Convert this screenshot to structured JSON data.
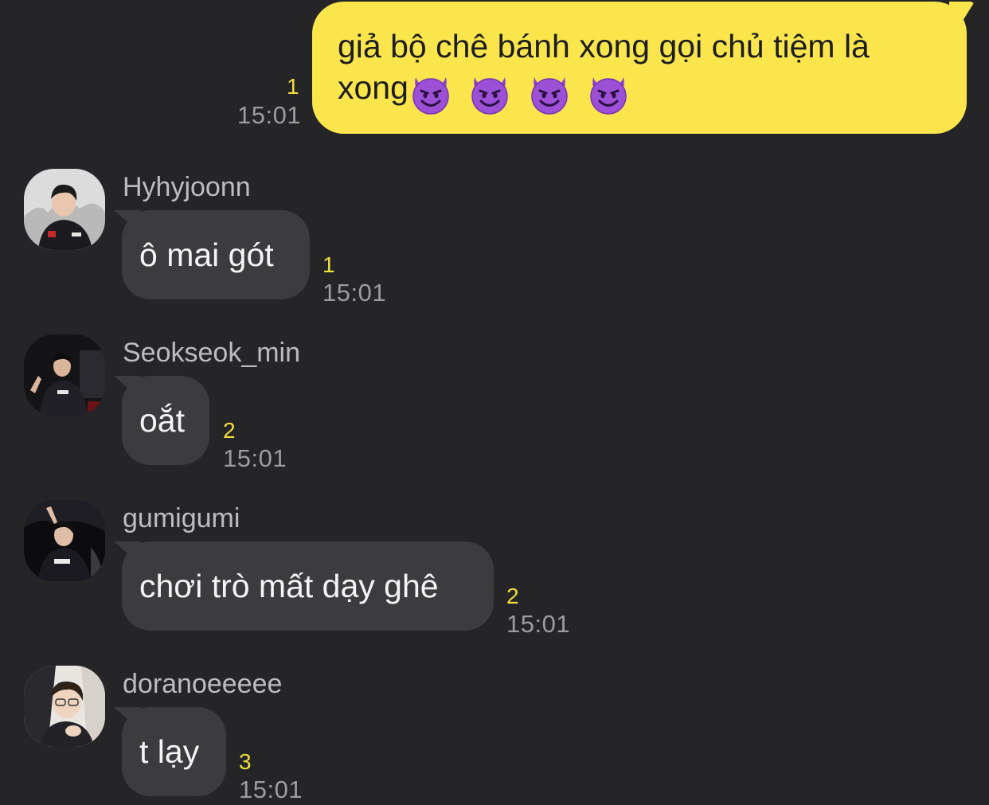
{
  "colors": {
    "background": "#252527",
    "outgoing_bubble": "#fae54d",
    "incoming_bubble": "#3c3c3e",
    "unread_count": "#f1df3e",
    "timestamp": "#9c9ca0",
    "sender_name": "#bdbdc1"
  },
  "outgoing": {
    "text": "giả bộ chê bánh xong gọi chủ tiệm là xong",
    "emoji": [
      "smiling-imp",
      "smiling-imp",
      "smiling-imp",
      "smiling-imp"
    ],
    "unread": "1",
    "time": "15:01"
  },
  "messages": [
    {
      "sender": "Hyhyjoonn",
      "avatar": "avatar-hyhyjoonn",
      "text": "ô mai gót",
      "unread": "1",
      "time": "15:01"
    },
    {
      "sender": "Seokseok_min",
      "avatar": "avatar-seokseok-min",
      "text": "oắt",
      "unread": "2",
      "time": "15:01"
    },
    {
      "sender": "gumigumi",
      "avatar": "avatar-gumigumi",
      "text": "chơi trò mất dạy ghê",
      "unread": "2",
      "time": "15:01"
    },
    {
      "sender": "doranoeeeee",
      "avatar": "avatar-doranoeeeee",
      "text": "t lạy",
      "unread": "3",
      "time": "15:01"
    }
  ]
}
